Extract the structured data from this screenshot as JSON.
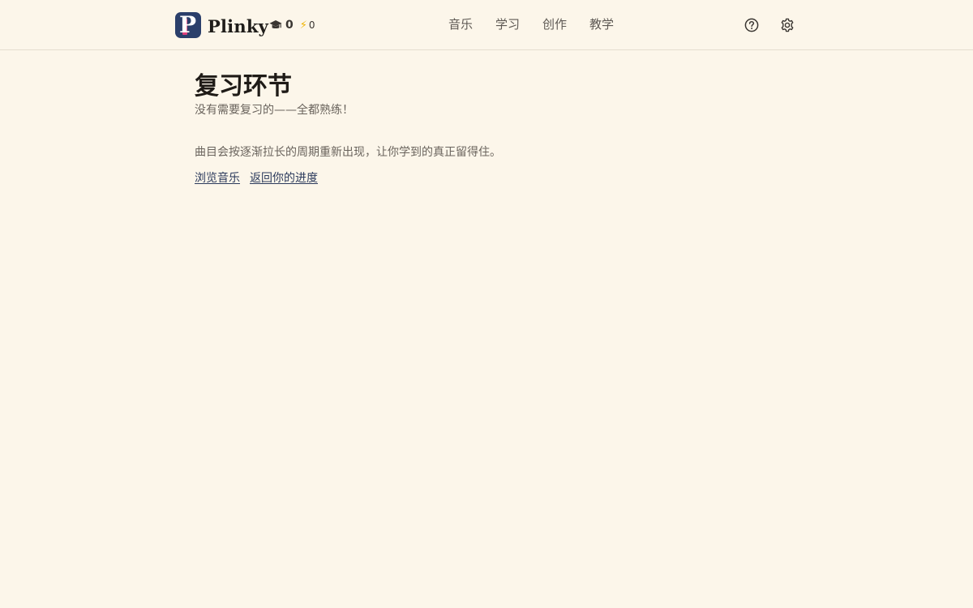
{
  "brand": {
    "name": "Plinky",
    "logo_letter": "P"
  },
  "stats": {
    "graduation_count": "0",
    "energy_count": "0"
  },
  "nav": {
    "items": [
      {
        "label": "音乐"
      },
      {
        "label": "学习"
      },
      {
        "label": "创作"
      },
      {
        "label": "教学"
      }
    ]
  },
  "header_icons": [
    "help-icon",
    "gear-icon"
  ],
  "main": {
    "title": "复习环节",
    "subtitle": "没有需要复习的——全都熟练！",
    "explanation": "曲目会按逐渐拉长的周期重新出现，让你学到的真正留得住。",
    "links": [
      {
        "label": "浏览音乐"
      },
      {
        "label": "返回你的进度"
      }
    ]
  },
  "colors": {
    "background": "#fcf6ea",
    "logo_bg": "#2b3f6b",
    "logo_accent": "#e0407c",
    "link": "#2b3a5c",
    "energy": "#f0b400"
  }
}
